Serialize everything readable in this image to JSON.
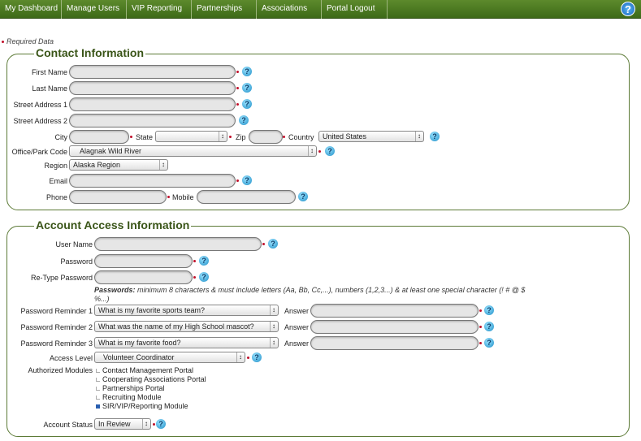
{
  "nav": {
    "items": [
      "My Dashboard",
      "Manage Users",
      "VIP Reporting",
      "Partnerships",
      "Associations",
      "Portal Logout"
    ],
    "help": "?"
  },
  "required_note": "Required Data",
  "contact": {
    "legend": "Contact Information",
    "labels": {
      "first": "First Name",
      "last": "Last Name",
      "street1": "Street Address 1",
      "street2": "Street Address 2",
      "city": "City",
      "state": "State",
      "zip": "Zip",
      "country": "Country",
      "office": "Office/Park Code",
      "region": "Region",
      "email": "Email",
      "phone": "Phone",
      "mobile": "Mobile"
    },
    "values": {
      "state": "",
      "country": "United States",
      "office": "Alagnak Wild River",
      "region": "Alaska Region"
    }
  },
  "account": {
    "legend": "Account Access Information",
    "labels": {
      "username": "User Name",
      "password": "Password",
      "retype": "Re-Type Password",
      "r1": "Password Reminder 1",
      "r2": "Password Reminder 2",
      "r3": "Password Reminder 3",
      "answer": "Answer",
      "access": "Access Level",
      "modules": "Authorized Modules",
      "status": "Account Status"
    },
    "note_bold": "Passwords:",
    "note": " minimum 8 characters & must include letters (Aa, Bb, Cc,...), numbers (1,2,3...) & at least one special character (! # @ $ %...)",
    "values": {
      "r1": "What is my favorite sports team?",
      "r2": "What was the name of my High School mascot?",
      "r3": "What is my favorite food?",
      "access": "Volunteer Coordinator",
      "status": "In Review"
    },
    "modules": [
      {
        "label": "Contact Management Portal",
        "checked": false
      },
      {
        "label": "Cooperating Associations Portal",
        "checked": false
      },
      {
        "label": "Partnerships Portal",
        "checked": false
      },
      {
        "label": "Recruiting Module",
        "checked": false
      },
      {
        "label": "SIR/VIP/Reporting Module",
        "checked": true
      }
    ]
  },
  "help_label": "?"
}
